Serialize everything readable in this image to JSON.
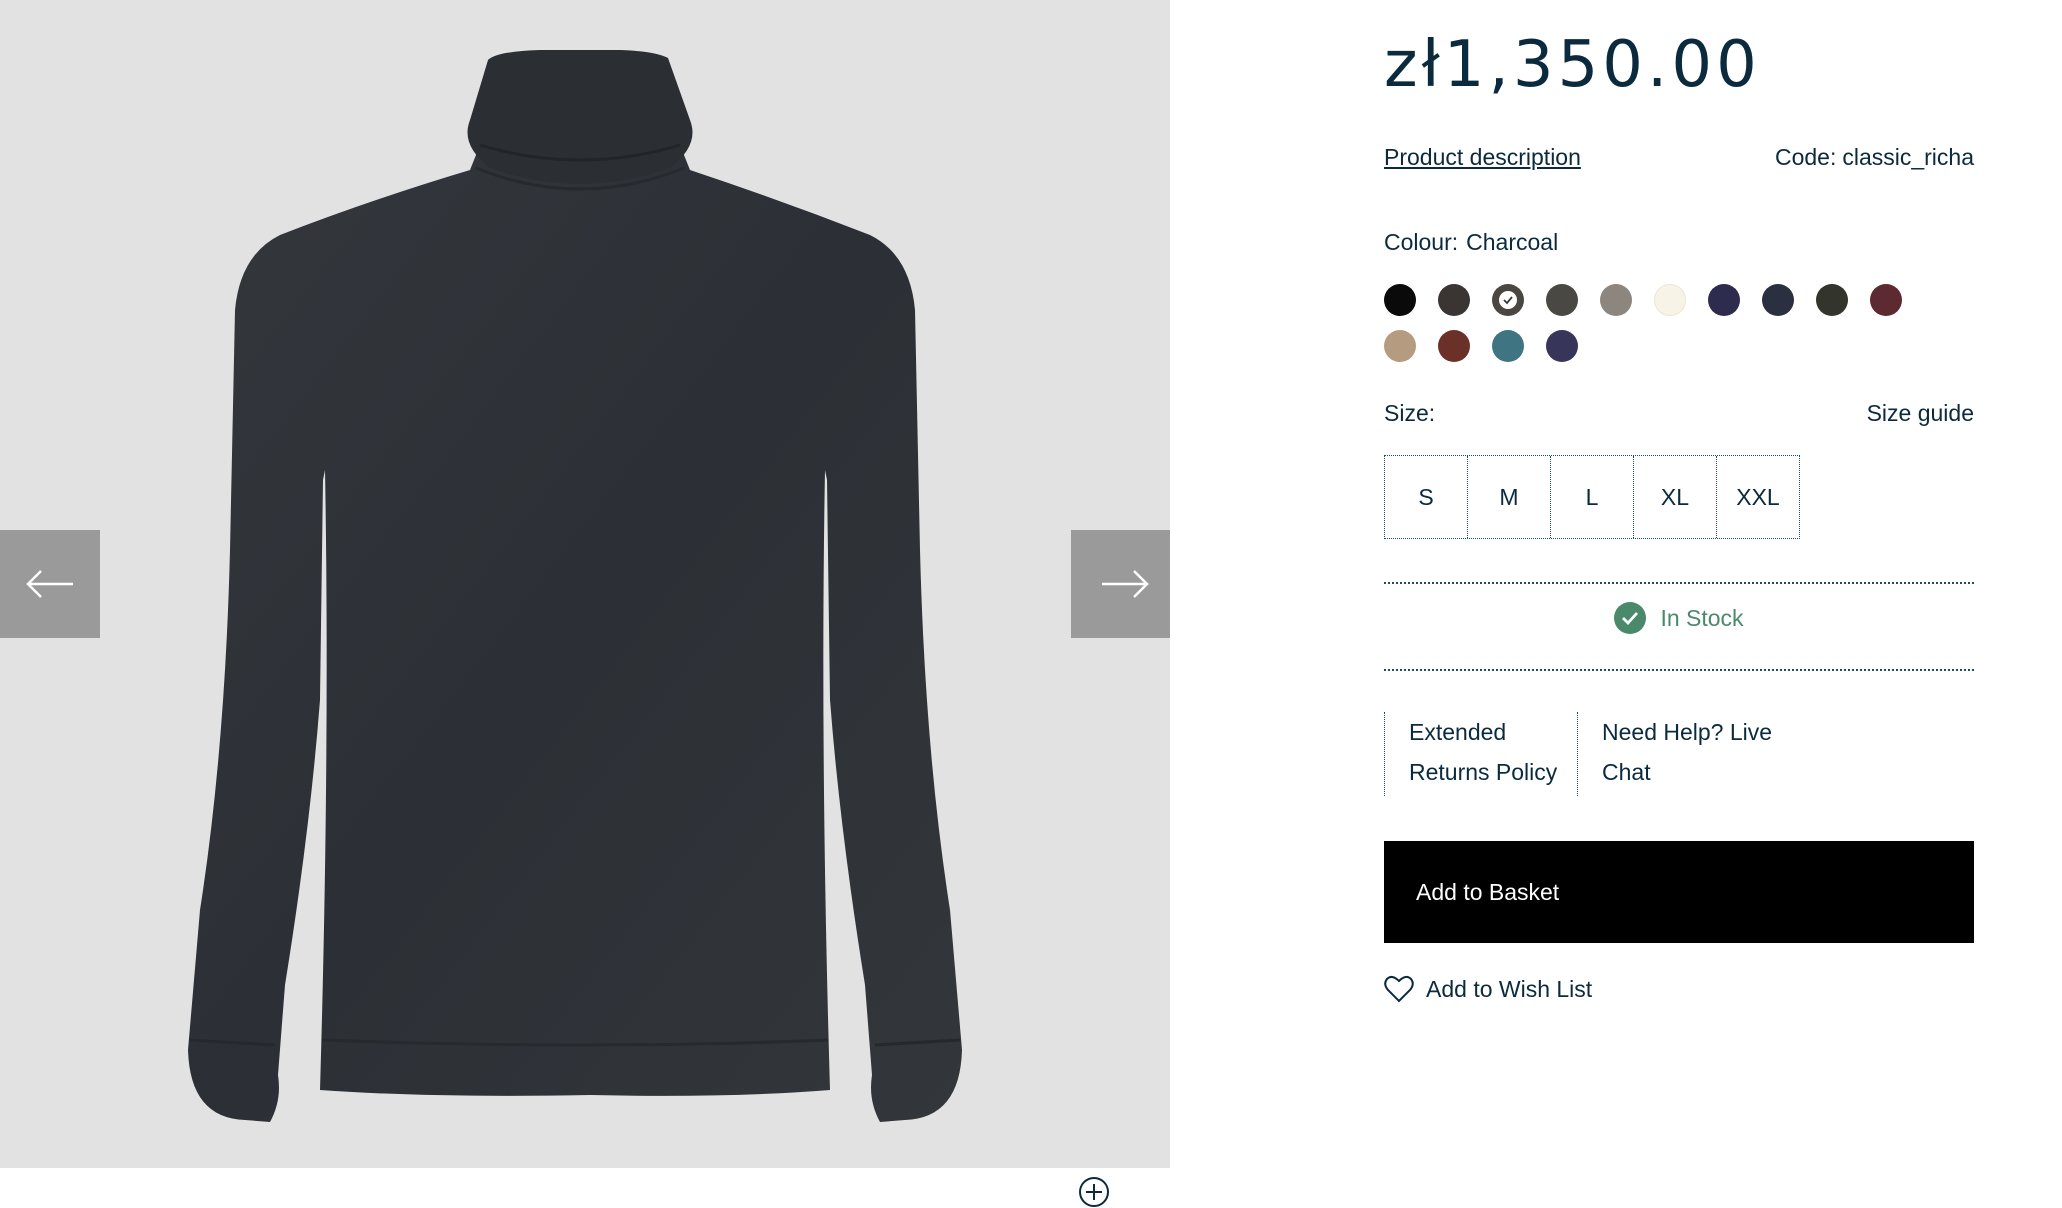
{
  "gallery": {
    "image_alt": "Charcoal roll neck sweater",
    "prev_icon": "arrow-left-icon",
    "next_icon": "arrow-right-icon",
    "zoom_icon": "zoom-plus-icon"
  },
  "product": {
    "price": "zł1,350.00",
    "description_link": "Product description",
    "code_label": "Code:",
    "code_value": "classic_richa",
    "colour_label": "Colour:",
    "colour_value": "Charcoal",
    "swatches": [
      {
        "color": "#0a0a0a",
        "selected": false
      },
      {
        "color": "#3a3533",
        "selected": false
      },
      {
        "color": "#3b3b3b",
        "selected": true
      },
      {
        "color": "#4a4843",
        "selected": false
      },
      {
        "color": "#8d867f",
        "selected": false
      },
      {
        "color": "#f7f3e6",
        "selected": false
      },
      {
        "color": "#2e2c4e",
        "selected": false
      },
      {
        "color": "#2b3040",
        "selected": false
      },
      {
        "color": "#33352c",
        "selected": false
      },
      {
        "color": "#5c2a30",
        "selected": false
      },
      {
        "color": "#b59c80",
        "selected": false
      },
      {
        "color": "#6b3129",
        "selected": false
      },
      {
        "color": "#3f7482",
        "selected": false
      },
      {
        "color": "#37355a",
        "selected": false
      }
    ],
    "size_label": "Size:",
    "size_guide": "Size guide",
    "sizes": [
      "S",
      "M",
      "L",
      "XL",
      "XXL"
    ],
    "stock_status": "In Stock",
    "stock_color": "#4a8a6b",
    "policy_returns_line1": "Extended",
    "policy_returns_line2": "Returns Policy",
    "policy_help_line1": "Need Help? Live",
    "policy_help_line2": "Chat",
    "add_to_basket": "Add to Basket",
    "add_to_wishlist": "Add to Wish List",
    "wishlist_icon": "heart-icon"
  }
}
